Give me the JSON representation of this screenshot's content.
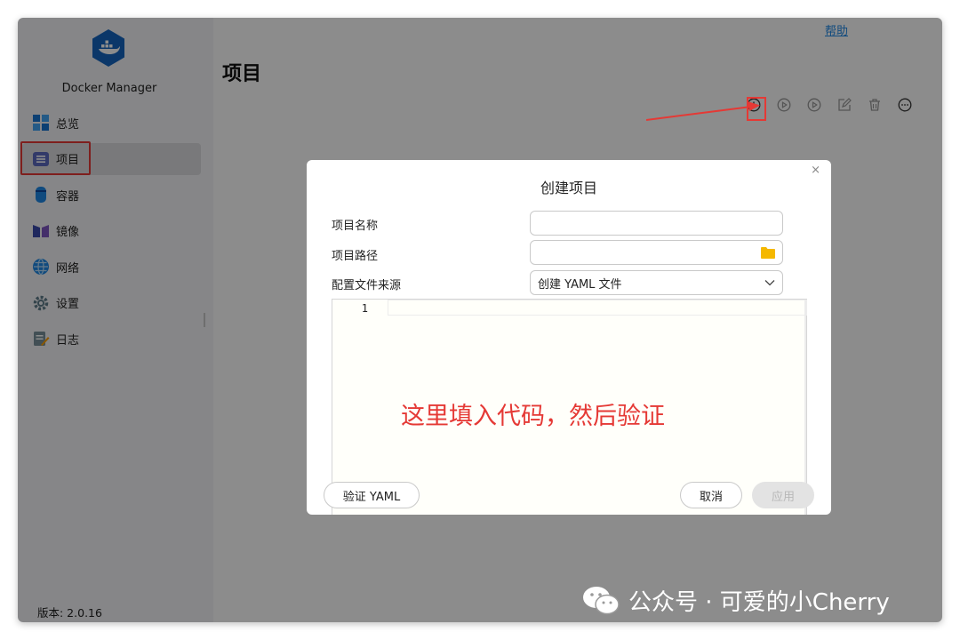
{
  "app": {
    "name": "Docker Manager",
    "version": "版本: 2.0.16",
    "help": "帮助"
  },
  "sidebar": {
    "items": [
      {
        "label": "总览",
        "icon": "overview-icon"
      },
      {
        "label": "项目",
        "icon": "project-list-icon",
        "active": true
      },
      {
        "label": "容器",
        "icon": "container-icon"
      },
      {
        "label": "镜像",
        "icon": "image-icon"
      },
      {
        "label": "网络",
        "icon": "network-globe-icon"
      },
      {
        "label": "设置",
        "icon": "gear-icon"
      },
      {
        "label": "日志",
        "icon": "log-icon"
      }
    ]
  },
  "main": {
    "title": "项目"
  },
  "toolbar": {
    "buttons": [
      {
        "name": "add-project-button",
        "icon": "plus-circle-icon"
      },
      {
        "name": "start-button",
        "icon": "play-circle-icon"
      },
      {
        "name": "stop-button",
        "icon": "play-circle-icon"
      },
      {
        "name": "edit-button",
        "icon": "edit-icon"
      },
      {
        "name": "delete-button",
        "icon": "trash-icon"
      },
      {
        "name": "more-button",
        "icon": "more-circle-icon"
      }
    ]
  },
  "dialog": {
    "title": "创建项目",
    "close": "×",
    "fields": {
      "name_label": "项目名称",
      "name_value": "",
      "path_label": "项目路径",
      "path_value": "",
      "source_label": "配置文件来源",
      "source_value": "创建 YAML 文件"
    },
    "editor": {
      "line_number": "1"
    },
    "annotation_text": "这里填入代码，然后验证",
    "buttons": {
      "validate": "验证 YAML",
      "cancel": "取消",
      "apply": "应用"
    }
  },
  "watermark": {
    "text": "公众号 · 可爱的小Cherry"
  },
  "colors": {
    "accent_blue": "#1e88e5",
    "annotation_red": "#e53935",
    "folder_yellow": "#f5b800",
    "docker_blue": "#1565c0"
  }
}
